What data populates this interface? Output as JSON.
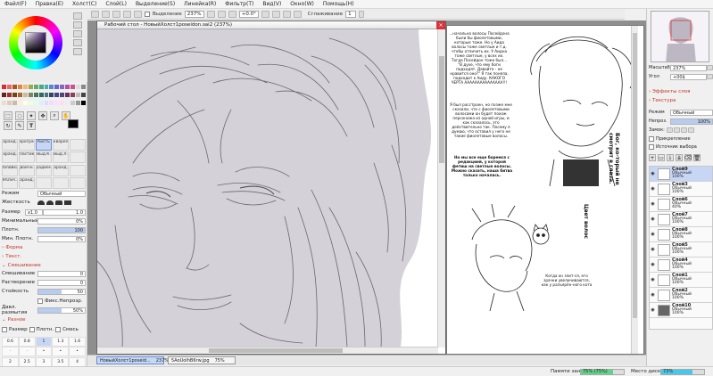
{
  "menu": [
    "Файл(F)",
    "Правка(E)",
    "Холст(C)",
    "Слой(L)",
    "Выделение(S)",
    "Линейка(R)",
    "Фильтр(T)",
    "Вид(V)",
    "Окно(W)",
    "Помощь(H)"
  ],
  "toolbar": {
    "selection_label": "Выделение",
    "zoom": "237%",
    "rotation": "+0.0°",
    "smoothing_label": "Сглаживание",
    "smoothing_value": "1"
  },
  "left": {
    "brush_names": [
      "Каранд...",
      "Аэрограф",
      "Кисть",
      "Акварель",
      "",
      "Каранд...",
      "Ластик",
      "Выд.К.",
      "Выд.Л.",
      "",
      "Заливка",
      "Двоичн...",
      "Градиент",
      "Каранд...",
      "",
      "BRUSH...",
      "Каранд...",
      "",
      "",
      ""
    ],
    "mode_label": "Режим",
    "mode_value": "Обычный",
    "hardness_label": "Жесткость",
    "size_label": "Размер",
    "size_mult": "x1.0",
    "size_value": "1.0",
    "min_size_label": "Минимальный",
    "min_size_value": "0%",
    "density_label": "Плотн.",
    "density_value": "100",
    "min_density_label": "Мин. Плотн.",
    "min_density_value": "0%",
    "section_shape": "Форма",
    "section_texture": "Текст.",
    "section_mixing": "Смешивание",
    "blend_label": "Смешивание",
    "blend_value": "0",
    "dilution_label": "Растворение",
    "dilution_value": "0",
    "persistence_label": "Стойкость",
    "persistence_value": "50",
    "keep_opacity_label": "Фикс.Непрозр.",
    "blur_pressure_label": "Давл. размытия",
    "blur_pressure_value": "50%",
    "section_misc": "Разное",
    "misc_checks": [
      "Размер",
      "Плотн.",
      "Смесь"
    ],
    "sizes": [
      "0.6",
      "0.8",
      "1",
      "1.3",
      "1.6",
      "",
      "",
      "",
      "",
      "",
      "2",
      "2.5",
      "3",
      "3.5",
      "4"
    ]
  },
  "canvas1": {
    "title": "Рабочий стол - НовыйХолст1poseidon.sai2 (237%)",
    "close": "×"
  },
  "manga": {
    "block1": "...начально волосы Посейдона были бы фиолетовыми, которые тоже. Но у Аида волосы тоже светлые и т.д. чтобы отличить их. У Аидна тоже светлые, у всех их. Тогда Посейдон тоже был... \"В духе, что ему боги подходят. Давайте - не нравится оно?\" Я так поняла, подходит к Аиду. КАКОГО ЧЕРТА ААААААААААААААА!!!",
    "block2": "Я был расстроен, но позже мне сказали, что с фиолетовыми волосами он будет похож персонажа из одной игры, и как сказалось, это действительно так. Посему я думаю, что оставил у него не такие фиолетовые волосы.",
    "block3": "Но мы все еще боремся с редакцией, у которой фетиш на светлые волосы. Можно сказать, наша битва только началась.",
    "vert1": "Бог, ко-торый не смотрит в глаза.",
    "vert2": "Цвет волос",
    "block4": "Когда он злит-ся, его зрачки увеличиваются, как у разъярён-ного кота"
  },
  "tabs": [
    {
      "name": "НовыйХолст1poseid...",
      "zoom": "237%"
    },
    {
      "name": "5AoUoIhB6rw.jpg",
      "zoom": "75%"
    }
  ],
  "status": {
    "memory_label": "Памяти занято",
    "memory_value": "75% (75%)",
    "memory_fraction": 0.75,
    "disk_label": "Место диска",
    "disk_value": "73%",
    "disk_fraction": 0.73,
    "memory_color": "#5fd38a",
    "disk_color": "#47c8e8"
  },
  "right": {
    "scale_label": "Масштаб",
    "scale_value": "237%",
    "angle_label": "Угол",
    "angle_value": "+00$",
    "section_effects": "Эффекты слоя",
    "section_texture": "Текстура",
    "mode_label": "Режим",
    "mode_value": "Обычный",
    "opacity_label": "Непроз.",
    "opacity_value": "100%",
    "lock_label": "Замок:",
    "clip_label": "Прикрепление",
    "source_label": "Источник выбора",
    "layers": [
      {
        "name": "Слой9",
        "mode": "Обычный",
        "opacity": "100%"
      },
      {
        "name": "Слой3",
        "mode": "Обычный",
        "opacity": "100%"
      },
      {
        "name": "Слой6",
        "mode": "Обычный",
        "opacity": "40%"
      },
      {
        "name": "Слой7",
        "mode": "Обычный",
        "opacity": "100%"
      },
      {
        "name": "Слой8",
        "mode": "Обычный",
        "opacity": "100%"
      },
      {
        "name": "Слой5",
        "mode": "Обычный",
        "opacity": "100%"
      },
      {
        "name": "Слой4",
        "mode": "Обычный",
        "opacity": "100%"
      },
      {
        "name": "Слой1",
        "mode": "Обычный",
        "opacity": "100%"
      },
      {
        "name": "Слой2",
        "mode": "Обычный",
        "opacity": "100%"
      },
      {
        "name": "Слой10",
        "mode": "Обычный",
        "opacity": "100%"
      }
    ]
  }
}
